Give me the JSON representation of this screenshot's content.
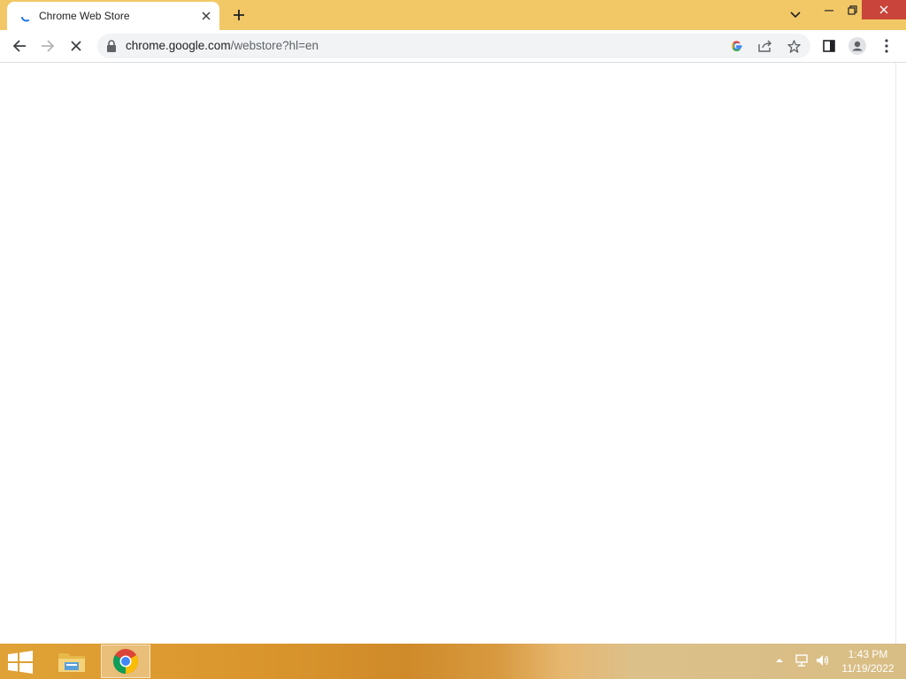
{
  "tab": {
    "title": "Chrome Web Store"
  },
  "address": {
    "host": "chrome.google.com",
    "path": "/webstore?hl=en"
  },
  "taskbar": {
    "time": "1:43 PM",
    "date": "11/19/2022"
  },
  "colors": {
    "titlebar": "#f2c867",
    "close": "#c9443a",
    "spinner": "#1a73e8"
  },
  "icons": {
    "tab": [
      "loading-spinner-icon",
      "close-icon",
      "plus-icon",
      "chevron-down-icon"
    ],
    "window": [
      "minimize-icon",
      "restore-icon",
      "close-icon"
    ],
    "toolbar": [
      "back-arrow-icon",
      "forward-arrow-icon",
      "stop-icon",
      "lock-icon",
      "google-icon",
      "share-icon",
      "star-icon",
      "side-panel-icon",
      "profile-icon",
      "kebab-menu-icon"
    ],
    "taskbar": [
      "windows-start-icon",
      "file-explorer-icon",
      "chrome-icon",
      "tray-up-arrow-icon",
      "network-icon",
      "volume-icon"
    ]
  }
}
